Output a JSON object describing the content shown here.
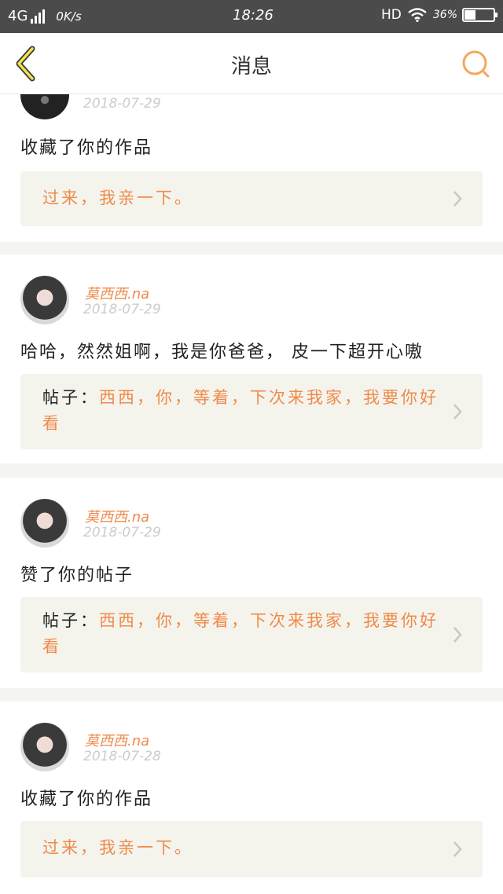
{
  "status_bar": {
    "network": "4G",
    "speed": "0K/s",
    "time": "18:26",
    "hd": "HD",
    "battery_percent": "36%",
    "battery_level": 0.36
  },
  "nav": {
    "title": "消息",
    "back_icon": "chevron-left-icon",
    "search_icon": "search-icon",
    "accent_color": "#f5a65b"
  },
  "messages": [
    {
      "username": "",
      "date": "2018-07-29",
      "action": "收藏了你的作品",
      "quote_prefix": "",
      "quote": "过来，我亲一下。"
    },
    {
      "username": "莫西西.na",
      "date": "2018-07-29",
      "action": "哈哈，然然姐啊，我是你爸爸， 皮一下超开心嗷",
      "quote_prefix": "帖子：",
      "quote": "西西，你，等着，下次来我家，我要你好看"
    },
    {
      "username": "莫西西.na",
      "date": "2018-07-29",
      "action": "赞了你的帖子",
      "quote_prefix": "帖子：",
      "quote": "西西，你，等着，下次来我家，我要你好看"
    },
    {
      "username": "莫西西.na",
      "date": "2018-07-28",
      "action": "收藏了你的作品",
      "quote_prefix": "",
      "quote": "过来，我亲一下。"
    }
  ]
}
